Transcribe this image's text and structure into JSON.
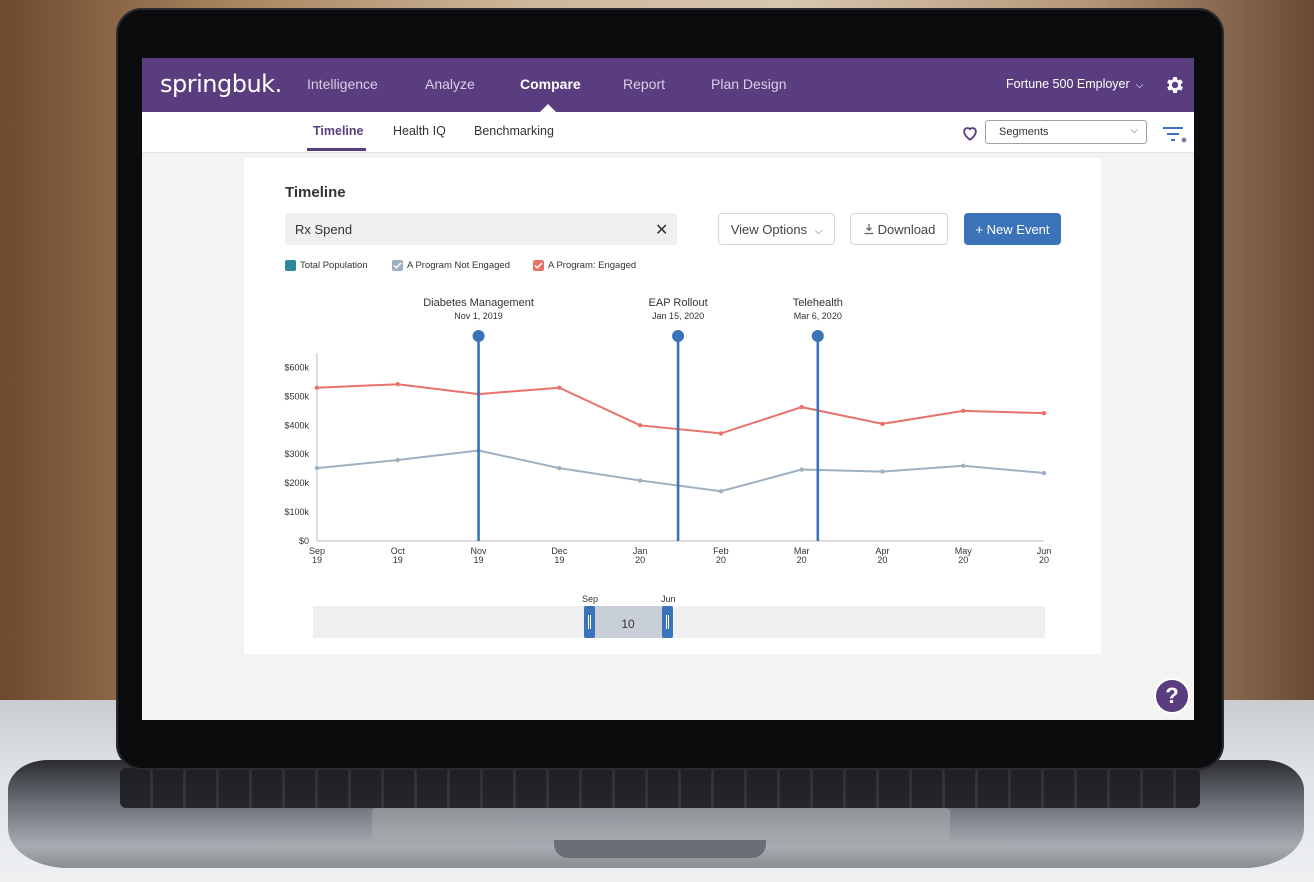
{
  "app": {
    "logo": "springbuk.",
    "nav": [
      "Intelligence",
      "Analyze",
      "Compare",
      "Report",
      "Plan Design"
    ],
    "active_nav": "Compare",
    "employer": "Fortune 500 Employer",
    "subtabs": [
      "Timeline",
      "Health IQ",
      "Benchmarking"
    ],
    "active_subtab": "Timeline",
    "segments_placeholder": "Segments",
    "help_label": "?"
  },
  "colors": {
    "brand": "#5a3d7e",
    "accent": "#3b73b9",
    "engaged": "#e8736b",
    "not_engaged": "#9fb0c2",
    "total": "#2e8a9a"
  },
  "icons": {
    "employer_menu": "chevron-down-icon",
    "settings": "gear-icon",
    "favorites": "heart-icon",
    "segments_menu": "chevron-down-icon",
    "filters": "filter-icon",
    "clear": "close-icon",
    "view_options": "chevron-down-icon",
    "download": "download-icon",
    "new_event": "plus-icon",
    "help": "help-icon"
  },
  "card": {
    "title": "Timeline",
    "metric": "Rx Spend",
    "clear_icon": "✕",
    "view_options": "View Options",
    "download": "Download",
    "new_event": "+ New Event"
  },
  "chart_data": {
    "type": "line",
    "x": [
      "Sep 19",
      "Oct 19",
      "Nov 19",
      "Dec 19",
      "Jan 20",
      "Feb 20",
      "Mar 20",
      "Apr 20",
      "May 20",
      "Jun 20"
    ],
    "x_ticks": [
      [
        "Sep",
        "19"
      ],
      [
        "Oct",
        "19"
      ],
      [
        "Nov",
        "19"
      ],
      [
        "Dec",
        "19"
      ],
      [
        "Jan",
        "20"
      ],
      [
        "Feb",
        "20"
      ],
      [
        "Mar",
        "20"
      ],
      [
        "Apr",
        "20"
      ],
      [
        "May",
        "20"
      ],
      [
        "Jun",
        "20"
      ]
    ],
    "y_ticks": [
      "$0",
      "$100k",
      "$200k",
      "$300k",
      "$400k",
      "$500k",
      "$600k"
    ],
    "ylim": [
      0,
      650000
    ],
    "legend": [
      {
        "name": "Total Population",
        "checked": false
      },
      {
        "name": "A Program Not Engaged",
        "checked": true
      },
      {
        "name": "A Program: Engaged",
        "checked": true
      }
    ],
    "series": [
      {
        "name": "A Program: Engaged",
        "values": [
          530000,
          542000,
          508000,
          530000,
          400000,
          372000,
          463000,
          405000,
          450000,
          442000
        ]
      },
      {
        "name": "A Program Not Engaged",
        "values": [
          252000,
          280000,
          313000,
          252000,
          209000,
          172000,
          247000,
          240000,
          260000,
          235000
        ]
      }
    ],
    "events": [
      {
        "name": "Diabetes Management",
        "date": "Nov 1, 2019",
        "x_index": 2
      },
      {
        "name": "EAP Rollout",
        "date": "Jan 15, 2020",
        "x_index": 4.47
      },
      {
        "name": "Telehealth",
        "date": "Mar 6, 2020",
        "x_index": 6.2
      }
    ],
    "range": {
      "start_label": "Sep",
      "end_label": "Jun",
      "count": "10"
    }
  }
}
